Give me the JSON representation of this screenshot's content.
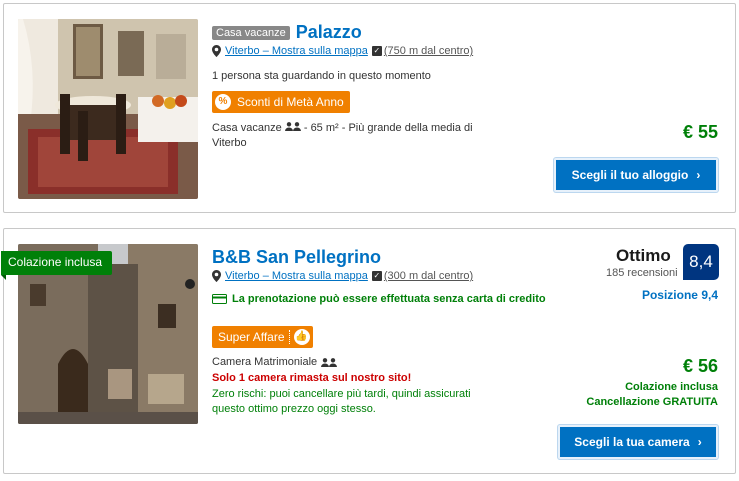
{
  "listings": [
    {
      "type_badge": "Casa vacanze",
      "name": "Palazzo",
      "location_link": "Viterbo – Mostra sulla mappa",
      "distance": "(750 m dal centro)",
      "viewers": "1 persona sta guardando in questo momento",
      "deal_badge": "Sconti di Metà Anno",
      "room_type": "Casa vacanze",
      "room_details": "- 65 m² - Più grande della media di",
      "room_details_2": "Viterbo",
      "price": "€ 55",
      "cta": "Scegli il tuo alloggio"
    },
    {
      "ribbon": "Colazione inclusa",
      "name": "B&B San Pellegrino",
      "location_link": "Viterbo – Mostra sulla mappa",
      "distance": "(300 m dal centro)",
      "no_card": "La prenotazione può essere effettuata senza carta di credito",
      "deal_badge": "Super Affare",
      "room_type": "Camera Matrimoniale",
      "scarcity": "Solo 1 camera rimasta sul nostro sito!",
      "risk_free": "Zero rischi: puoi cancellare più tardi, quindi assicurati questo ottimo prezzo oggi stesso.",
      "rating_word": "Ottimo",
      "review_count": "185 recensioni",
      "score": "8,4",
      "position": "Posizione 9,4",
      "price": "€ 56",
      "breakfast": "Colazione inclusa",
      "cancellation": "Cancellazione GRATUITA",
      "cta": "Scegli la tua camera"
    }
  ],
  "colors": {
    "brand_blue": "#0071c2",
    "score_navy": "#003580",
    "price_green": "#008009",
    "deal_orange": "#f08000",
    "scarcity_red": "#cc0000"
  },
  "icons": [
    "map-pin-icon",
    "checkbox-icon",
    "percent-icon",
    "guests-icon",
    "credit-card-icon",
    "thumbs-up-icon",
    "chevron-right-icon"
  ]
}
